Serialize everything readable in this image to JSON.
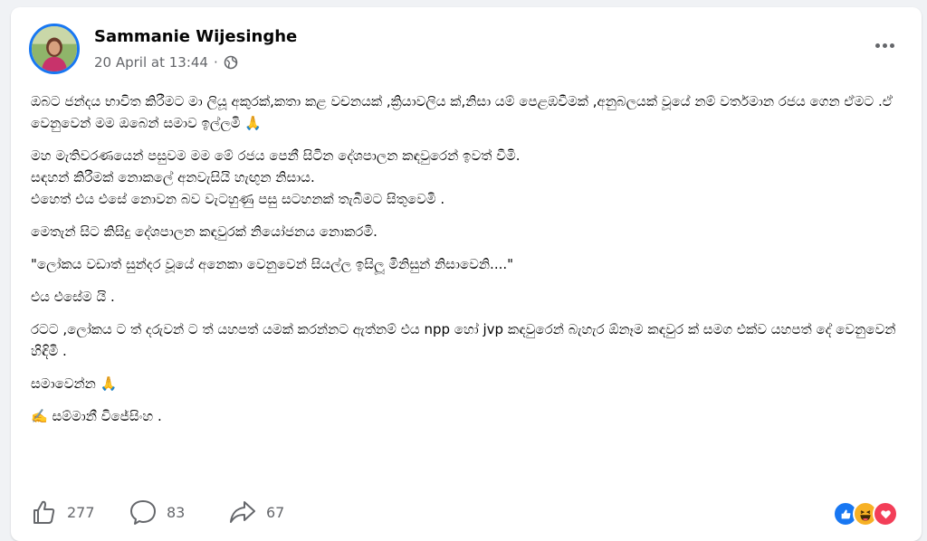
{
  "post": {
    "author": "Sammanie Wijesinghe",
    "timestamp": "20 April at 13:44",
    "separator": "·",
    "privacy_icon": "globe-icon",
    "more_icon": "more-options-icon",
    "paragraphs": [
      "ඔබට ජන්දය භාවිත කිරීමට මා ලියූ අකුරක්,කතා කළ වචනයක් ,ක්‍රියාවලිය ක්,නිසා යම් පෙළඹවීමක් ,අනුබලයක් වූයේ නම් වර්තමාන රජය ගෙන ඒමට  .ඒ වෙනුවෙන් මම ඔබෙන් සමාව ඉල්ලමි  🙏",
      "මහ මැතිවරණයෙන් පසුවම මම මේ රජය පෙනී සිටින දේශපාලන කඳවුරෙන් ඉවත් වීමි.\nසඳහන් කිරීමක් නොකලේ අනවැසියි හැඟුන නිසාය.\nඑහෙත් එය එසේ නොවන බව වැටහුණු පසු සටහනක් තැබීමට සිතුවෙමි .",
      "මෙතැන් සිට කිසිදු දේශපාලන කඳවුරක් නියෝජනය නොකරමි.",
      "\"ලෝකය වඩාත්  සුන්දර වූයේ අනෙකා වෙනුවෙන් සියල්ල ඉසිලූ  මිනිසුන්  නිසාවෙනි....\"",
      "එය එසේම යි .",
      "රටට ,ලෝකය ට ත් දරුවන් ට ත් යහපත් යමක් කරන්නට ඇත්නම් එය npp  හෝ jvp කඳවුරෙන් බැහැර ඕනෑම කඳවුර ක් සමග එක්ව යහපත් දේ වෙනුවෙන් හිඳිමි .",
      "සමාවෙන්න 🙏",
      "✍️ සම්මානී විජේසිංහ ."
    ]
  },
  "actions": {
    "like": {
      "icon": "like-icon",
      "count": "277"
    },
    "comment": {
      "icon": "comment-icon",
      "count": "83"
    },
    "share": {
      "icon": "share-icon",
      "count": "67"
    }
  },
  "reactions": [
    {
      "icon": "like-reaction-icon",
      "color": "#1877f2"
    },
    {
      "icon": "haha-reaction-icon",
      "color": "#f7b125"
    },
    {
      "icon": "love-reaction-icon",
      "color": "#f33e58"
    }
  ],
  "colors": {
    "accent": "#1877f2",
    "secondary_text": "#65676b",
    "background": "#f0f2f5"
  }
}
